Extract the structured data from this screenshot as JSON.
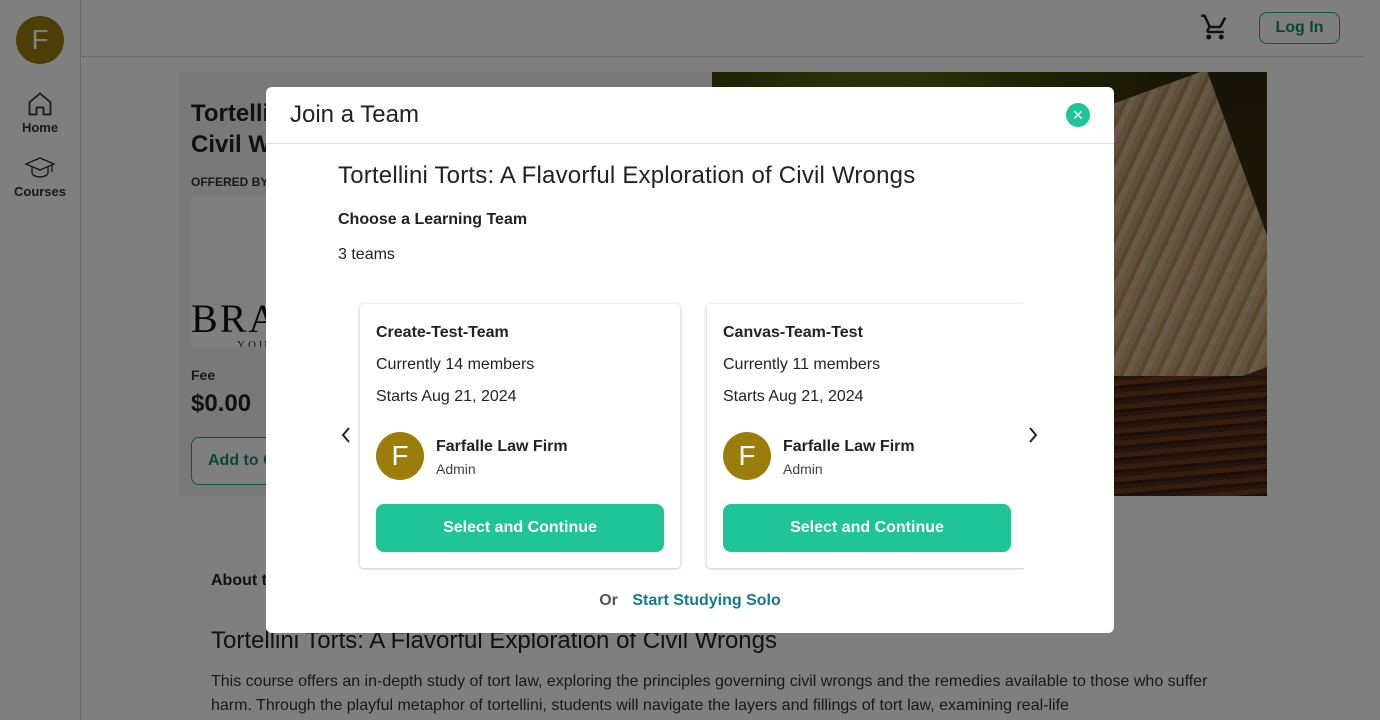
{
  "sidebar": {
    "avatar_initial": "F",
    "items": [
      {
        "label": "Home",
        "icon": "home-icon"
      },
      {
        "label": "Courses",
        "icon": "graduation-cap-icon"
      }
    ]
  },
  "header": {
    "cart_icon": "cart-icon",
    "login_label": "Log In"
  },
  "course_page": {
    "title": "Tortellini Torts: A Flavorful Exploration of Civil Wrongs",
    "offered_by_label": "OFFERED BY",
    "brand_logo_text": "BRA",
    "brand_logo_sub": "YOU",
    "fee_label": "Fee",
    "fee_value": "$0.00",
    "add_to_cart_label": "Add to Cart",
    "about_label": "About this course",
    "about_title": "Tortellini Torts: A Flavorful Exploration of Civil Wrongs",
    "about_description": "This course offers an in-depth study of tort law, exploring the principles governing civil wrongs and the remedies available to those who suffer harm. Through the playful metaphor of tortellini, students will navigate the layers and fillings of tort law, examining real-life"
  },
  "modal": {
    "title": "Join a Team",
    "close_icon": "close-icon",
    "course_name": "Tortellini Torts: A Flavorful Exploration of Civil Wrongs",
    "choose_label": "Choose a Learning Team",
    "teams_count": "3 teams",
    "teams": [
      {
        "name": "Create-Test-Team",
        "members": "Currently 14 members",
        "starts": "Starts Aug 21, 2024",
        "org_initial": "F",
        "org_name": "Farfalle Law Firm",
        "org_role": "Admin",
        "button_label": "Select and Continue"
      },
      {
        "name": "Canvas-Team-Test",
        "members": "Currently 11 members",
        "starts": "Starts Aug 21, 2024",
        "org_initial": "F",
        "org_name": "Farfalle Law Firm",
        "org_role": "Admin",
        "button_label": "Select and Continue"
      }
    ],
    "or_label": "Or",
    "solo_label": "Start Studying Solo"
  },
  "colors": {
    "accent": "#1fc497",
    "avatar": "#9a7d0a",
    "link": "#137a8c"
  }
}
